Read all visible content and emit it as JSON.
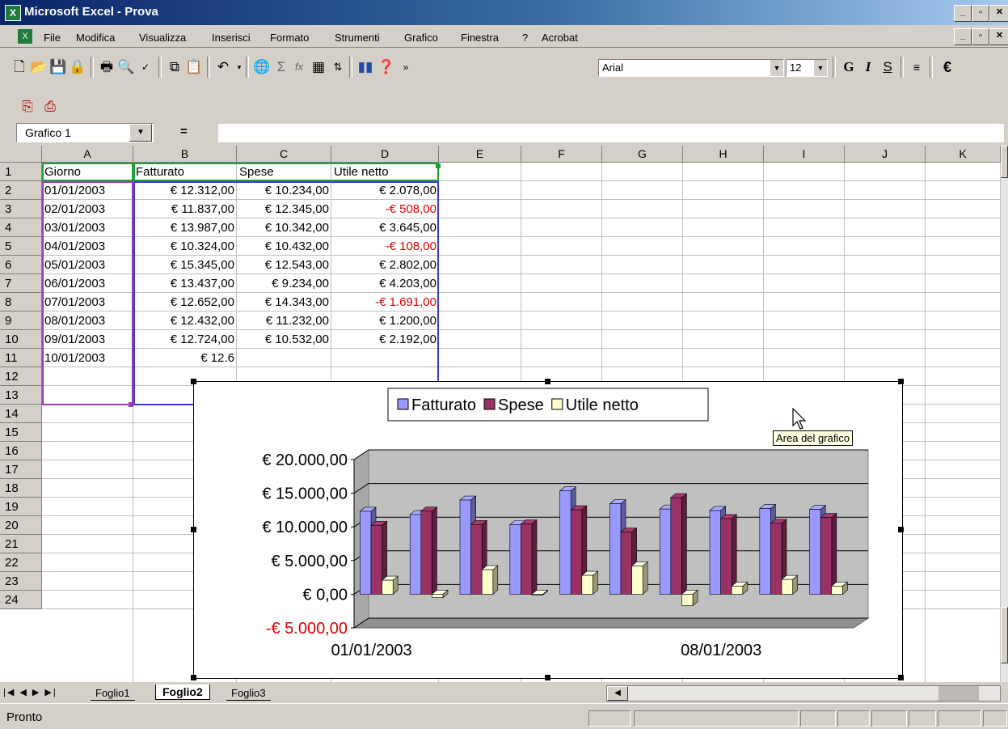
{
  "window": {
    "title": "Microsoft Excel - Prova",
    "app_icon": "excel-icon"
  },
  "menu": [
    "File",
    "Modifica",
    "Visualizza",
    "Inserisci",
    "Formato",
    "Strumenti",
    "Grafico",
    "Finestra",
    "?",
    "Acrobat"
  ],
  "toolbar": {
    "font_name": "Arial",
    "font_size": "12",
    "bold": "G",
    "italic": "I",
    "strike": "S",
    "euro": "€",
    "sigma": "Σ",
    "fx": "fx"
  },
  "name_box": {
    "value": "Grafico 1",
    "equals": "="
  },
  "columns": [
    "A",
    "B",
    "C",
    "D",
    "E",
    "F",
    "G",
    "H",
    "I",
    "J",
    "K"
  ],
  "rows": [
    "1",
    "2",
    "3",
    "4",
    "5",
    "6",
    "7",
    "8",
    "9",
    "10",
    "11",
    "12",
    "13",
    "14",
    "15",
    "16",
    "17",
    "18",
    "19",
    "20",
    "21",
    "22",
    "23",
    "24"
  ],
  "headers": [
    "Giorno",
    "Fatturato",
    "Spese",
    "Utile netto"
  ],
  "table": [
    [
      "01/01/2003",
      "€ 12.312,00",
      "€ 10.234,00",
      "€ 2.078,00"
    ],
    [
      "02/01/2003",
      "€ 11.837,00",
      "€ 12.345,00",
      "-€ 508,00"
    ],
    [
      "03/01/2003",
      "€ 13.987,00",
      "€ 10.342,00",
      "€ 3.645,00"
    ],
    [
      "04/01/2003",
      "€ 10.324,00",
      "€ 10.432,00",
      "-€ 108,00"
    ],
    [
      "05/01/2003",
      "€ 15.345,00",
      "€ 12.543,00",
      "€ 2.802,00"
    ],
    [
      "06/01/2003",
      "€ 13.437,00",
      "€ 9.234,00",
      "€ 4.203,00"
    ],
    [
      "07/01/2003",
      "€ 12.652,00",
      "€ 14.343,00",
      "-€ 1.691,00"
    ],
    [
      "08/01/2003",
      "€ 12.432,00",
      "€ 11.232,00",
      "€ 1.200,00"
    ],
    [
      "09/01/2003",
      "€ 12.724,00",
      "€ 10.532,00",
      "€ 2.192,00"
    ],
    [
      "10/01/2003",
      "€ 12.6"
    ]
  ],
  "chart_data": {
    "type": "bar",
    "categories": [
      "01/01/2003",
      "02/01/2003",
      "03/01/2003",
      "04/01/2003",
      "05/01/2003",
      "06/01/2003",
      "07/01/2003",
      "08/01/2003",
      "09/01/2003",
      "10/01/2003"
    ],
    "tick_labels": [
      "01/01/2003",
      "08/01/2003"
    ],
    "series": [
      {
        "name": "Fatturato",
        "values": [
          12312,
          11837,
          13987,
          10324,
          15345,
          13437,
          12652,
          12432,
          12724,
          12600
        ],
        "color": "#9999ff"
      },
      {
        "name": "Spese",
        "values": [
          10234,
          12345,
          10342,
          10432,
          12543,
          9234,
          14343,
          11232,
          10532,
          11400
        ],
        "color": "#993366"
      },
      {
        "name": "Utile netto",
        "values": [
          2078,
          -508,
          3645,
          -108,
          2802,
          4203,
          -1691,
          1200,
          2192,
          1200
        ],
        "color": "#ffffcc"
      }
    ],
    "y_ticks": [
      "€ 20.000,00",
      "€ 15.000,00",
      "€ 10.000,00",
      "€ 5.000,00",
      "€ 0,00",
      "-€ 5.000,00"
    ],
    "ylim": [
      -5000,
      20000
    ],
    "legend": "top",
    "grid": true,
    "style": "3d-clustered-column"
  },
  "tooltip": "Area del grafico",
  "sheets": [
    "Foglio1",
    "Foglio2",
    "Foglio3"
  ],
  "active_sheet": "Foglio2",
  "status": "Pronto"
}
